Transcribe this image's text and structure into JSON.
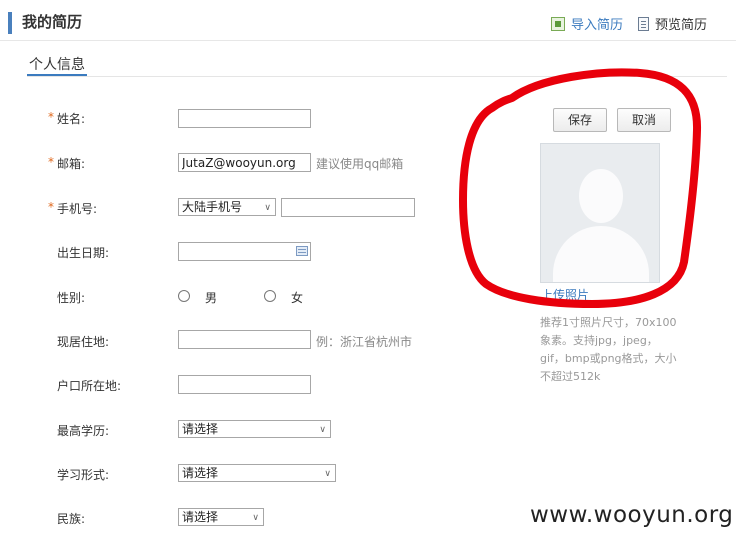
{
  "header": {
    "title": "我的简历",
    "import_label": "导入简历",
    "preview_label": "预览简历"
  },
  "section": {
    "title": "个人信息"
  },
  "form": {
    "name_label": "姓名:",
    "email_label": "邮箱:",
    "email_value": "JutaZ@wooyun.org",
    "email_hint": "建议使用qq邮箱",
    "phone_label": "手机号:",
    "phone_region": "大陆手机号",
    "birth_label": "出生日期:",
    "gender_label": "性别:",
    "gender_male": "男",
    "gender_female": "女",
    "residence_label": "现居住地:",
    "residence_hint": "例：浙江省杭州市",
    "hukou_label": "户口所在地:",
    "education_label": "最高学历:",
    "education_value": "请选择",
    "study_label": "学习形式:",
    "study_value": "请选择",
    "ethnic_label": "民族:",
    "ethnic_value": "请选择",
    "required_mark": "*"
  },
  "photo_panel": {
    "save_label": "保存",
    "cancel_label": "取消",
    "upload_label": "上传照片",
    "tip_lines": [
      "推荐1寸照片尺寸，70x100",
      "象素。支持jpg，jpeg，",
      "gif，bmp或png格式，大小",
      "不超过512k"
    ]
  },
  "watermark": "www.wooyun.org",
  "colors": {
    "accent": "#3b7bbf",
    "required": "#e0691f",
    "annotation": "#e8000b"
  }
}
